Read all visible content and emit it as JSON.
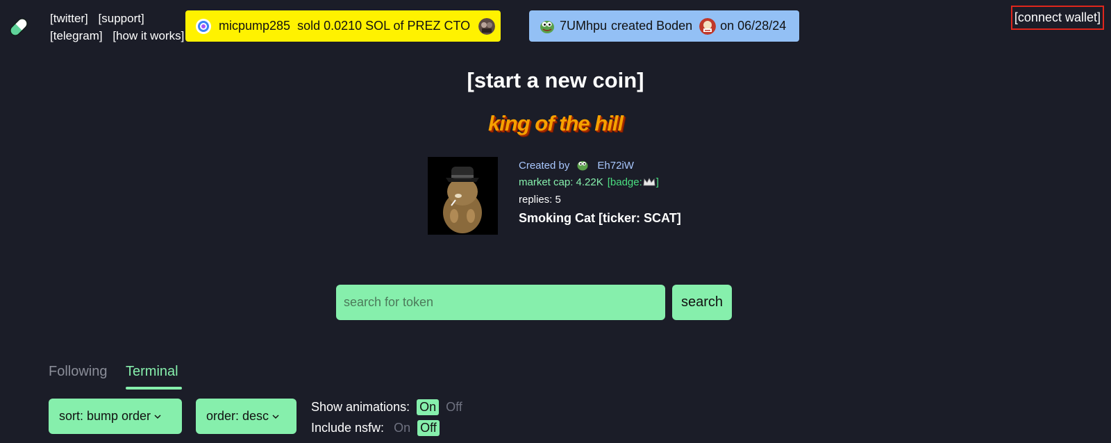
{
  "header": {
    "nav_links": {
      "twitter": "[twitter]",
      "support": "[support]",
      "telegram": "[telegram]",
      "how_it_works": "[how it works]"
    },
    "ticker_trade": {
      "user": "micpump285",
      "action": "sold 0.0210 SOL of PREZ CTO"
    },
    "ticker_create": {
      "user": "7UMhpu",
      "action": "created Boden",
      "date": "on 06/28/24"
    },
    "connect_wallet": "[connect wallet]"
  },
  "hero": {
    "start_coin": "[start a new coin]",
    "king_of_the_hill": "king of the hill"
  },
  "king_coin": {
    "created_by_label": "Created by",
    "creator": "Eh72iW",
    "market_cap": "market cap: 4.22K",
    "badge": "[badge:",
    "badge_end": "]",
    "replies": "replies: 5",
    "name": "Smoking Cat [ticker: SCAT]"
  },
  "search": {
    "placeholder": "search for token",
    "button": "search"
  },
  "tabs": {
    "following": "Following",
    "terminal": "Terminal",
    "active": "Terminal"
  },
  "controls": {
    "sort": "sort: bump order",
    "order": "order: desc",
    "show_animations_label": "Show animations:",
    "show_animations_on": "On",
    "show_animations_off": "Off",
    "show_animations_value": "On",
    "include_nsfw_label": "Include nsfw:",
    "include_nsfw_on": "On",
    "include_nsfw_off": "Off",
    "include_nsfw_value": "Off"
  },
  "colors": {
    "background": "#1b1d28",
    "accent_green": "#86efac",
    "ticker_yellow": "#fff200",
    "ticker_blue": "#93c0f5",
    "highlight_red": "#e0261c"
  }
}
